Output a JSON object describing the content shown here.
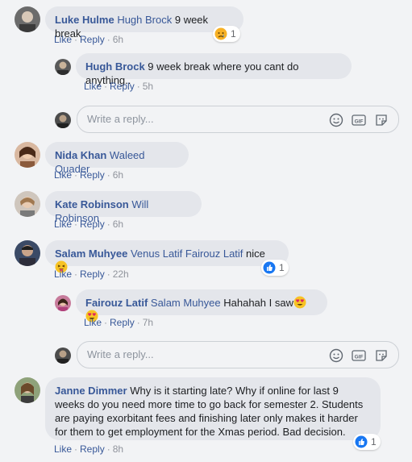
{
  "comments": [
    {
      "author": "Luke Hulme",
      "tag": "Hugh Brock",
      "text": " 9 week break",
      "actions": {
        "like": "Like",
        "reply": "Reply",
        "time": "6h"
      },
      "reaction_count": "1"
    },
    {
      "author": "Hugh Brock",
      "tag": "",
      "text": " 9 week break where you cant do anything..",
      "actions": {
        "like": "Like",
        "reply": "Reply",
        "time": "5h"
      }
    },
    {
      "author": "Nida Khan",
      "tag": "Waleed Quader",
      "text": "",
      "actions": {
        "like": "Like",
        "reply": "Reply",
        "time": "6h"
      }
    },
    {
      "author": "Kate Robinson",
      "tag": "Will Robinson",
      "text": "",
      "actions": {
        "like": "Like",
        "reply": "Reply",
        "time": "6h"
      }
    },
    {
      "author": "Salam Muhyee",
      "tag": "Venus Latif Fairouz Latif",
      "text": " nice ",
      "actions": {
        "like": "Like",
        "reply": "Reply",
        "time": "22h"
      },
      "reaction_count": "1"
    },
    {
      "author": "Fairouz Latif",
      "tag": "Salam Muhyee",
      "text": " Hahahah I saw",
      "actions": {
        "like": "Like",
        "reply": "Reply",
        "time": "7h"
      }
    },
    {
      "author": "Janne Dimmer",
      "tag": "",
      "text": " Why is it starting late? Why if online for last 9 weeks do you need more time to go back for semester 2. Students are paying exorbitant fees and finishing later only makes it harder for them to get employment for the Xmas period. Bad decision.",
      "actions": {
        "like": "Like",
        "reply": "Reply",
        "time": "8h"
      },
      "reaction_count": "1"
    }
  ],
  "reply_box": {
    "placeholder": "Write a reply..."
  },
  "icons": [
    "smiley-icon",
    "gif-icon",
    "sticker-icon",
    "sad-reaction-icon",
    "like-reaction-icon",
    "heart-eyes-emoji",
    "tongue-emoji"
  ],
  "colors": {
    "link": "#385898",
    "bubble": "#e4e6eb",
    "like_blue": "#1877f2"
  }
}
